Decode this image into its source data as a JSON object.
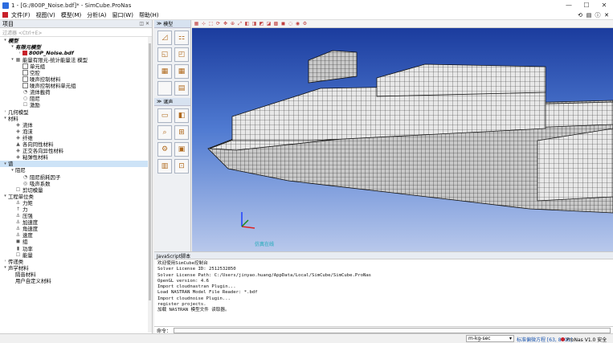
{
  "window": {
    "title": "1 - [G:/800P_Noise.bdf]* - SimCube.ProNas",
    "controls": [
      "—",
      "☐",
      "✕"
    ]
  },
  "menu": {
    "items": [
      "文件(F)",
      "视图(V)",
      "模型(M)",
      "分析(A)",
      "窗口(W)",
      "帮助(H)"
    ]
  },
  "left_panel": {
    "title": "项目",
    "filter_placeholder": "过滤器 <Ctrl+E>",
    "tree": [
      {
        "indent": 0,
        "tw": "▾",
        "icon": "",
        "label": "模型",
        "bold": true
      },
      {
        "indent": 1,
        "tw": "▾",
        "icon": "",
        "label": "有限元模型",
        "bold": true
      },
      {
        "indent": 2,
        "tw": "›",
        "icon": "red",
        "label": "800P_Noise.bdf",
        "bold": true
      },
      {
        "indent": 1,
        "tw": "▾",
        "icon": "▦",
        "label": "能量有限元-统计能量法 模型"
      },
      {
        "indent": 2,
        "tw": "",
        "icon": "chk",
        "label": "单元组"
      },
      {
        "indent": 2,
        "tw": "",
        "icon": "chk",
        "label": "空腔"
      },
      {
        "indent": 2,
        "tw": "",
        "icon": "chk",
        "label": "噪声控制材料"
      },
      {
        "indent": 2,
        "tw": "",
        "icon": "chk",
        "label": "噪声控制材料单元组"
      },
      {
        "indent": 2,
        "tw": "",
        "icon": "◔",
        "label": "流体載荷"
      },
      {
        "indent": 2,
        "tw": "",
        "icon": "○",
        "label": "阻尼"
      },
      {
        "indent": 2,
        "tw": "",
        "icon": "☐",
        "label": "激励"
      },
      {
        "indent": 0,
        "tw": "›",
        "icon": "",
        "label": "几何模型"
      },
      {
        "indent": 0,
        "tw": "▾",
        "icon": "",
        "label": "材料"
      },
      {
        "indent": 1,
        "tw": "",
        "icon": "◈",
        "label": "流体"
      },
      {
        "indent": 1,
        "tw": "",
        "icon": "◈",
        "label": "泡沫"
      },
      {
        "indent": 1,
        "tw": "",
        "icon": "◈",
        "label": "纤维"
      },
      {
        "indent": 1,
        "tw": "",
        "icon": "▲",
        "label": "各向同性材料"
      },
      {
        "indent": 1,
        "tw": "",
        "icon": "◈",
        "label": "正交各向异性材料"
      },
      {
        "indent": 1,
        "tw": "",
        "icon": "◈",
        "label": "粘弹性材料"
      },
      {
        "indent": 0,
        "tw": "▾",
        "icon": "",
        "label": "谱",
        "sel": true
      },
      {
        "indent": 1,
        "tw": "▾",
        "icon": "",
        "label": "阻尼"
      },
      {
        "indent": 2,
        "tw": "",
        "icon": "◔",
        "label": "阻尼损耗因子"
      },
      {
        "indent": 2,
        "tw": "",
        "icon": "◎",
        "label": "吸声系数"
      },
      {
        "indent": 1,
        "tw": "",
        "icon": "☐",
        "label": "剪切模量"
      },
      {
        "indent": 0,
        "tw": "▾",
        "icon": "",
        "label": "工程单位类"
      },
      {
        "indent": 1,
        "tw": "",
        "icon": "⚓",
        "label": "力矩"
      },
      {
        "indent": 1,
        "tw": "",
        "icon": "↑",
        "label": "力"
      },
      {
        "indent": 1,
        "tw": "",
        "icon": "⚓",
        "label": "压强"
      },
      {
        "indent": 1,
        "tw": "",
        "icon": "⚓",
        "label": "加速度"
      },
      {
        "indent": 1,
        "tw": "",
        "icon": "⚓",
        "label": "角速度"
      },
      {
        "indent": 1,
        "tw": "",
        "icon": "⚓",
        "label": "速度"
      },
      {
        "indent": 1,
        "tw": "",
        "icon": "◼",
        "label": "组"
      },
      {
        "indent": 1,
        "tw": "",
        "icon": "▮",
        "label": "功率"
      },
      {
        "indent": 1,
        "tw": "",
        "icon": "☐",
        "label": "能量"
      },
      {
        "indent": 0,
        "tw": "›",
        "icon": "",
        "label": "传递类"
      },
      {
        "indent": 0,
        "tw": "▾",
        "icon": "",
        "label": "声学材料"
      },
      {
        "indent": 1,
        "tw": "",
        "icon": "",
        "label": "隔音材料"
      },
      {
        "indent": 1,
        "tw": "",
        "icon": "",
        "label": "用户自定义材料"
      }
    ]
  },
  "tool_panel": {
    "section_model": "模型",
    "section_tools": "诸声"
  },
  "viewport": {
    "watermark": "仿真在线"
  },
  "console": {
    "title": "JavaScript脚本",
    "lines": [
      "欢迎使用SimCube控制台",
      "Solver License ID: 2512532850",
      "Solver License Path: C:/Users/jinyao.huang/AppData/Local/SimCube/SimCube.ProNas",
      "OpenGL version: 4.6",
      "Import cloudnastran Plugin...",
      "Load NASTRAN Model File Reader: *.bdf",
      "Import cloudnoise Plugin...",
      "register projects.",
      "加载 NASTRAN 模型文件 读取器。"
    ],
    "cmd_label": "命令："
  },
  "status": {
    "unit_system": "m-kg-sec",
    "coords": "标准偏微方程 [63, 8000]",
    "version": "ProNas V1.0 安全",
    "tray": "●"
  }
}
